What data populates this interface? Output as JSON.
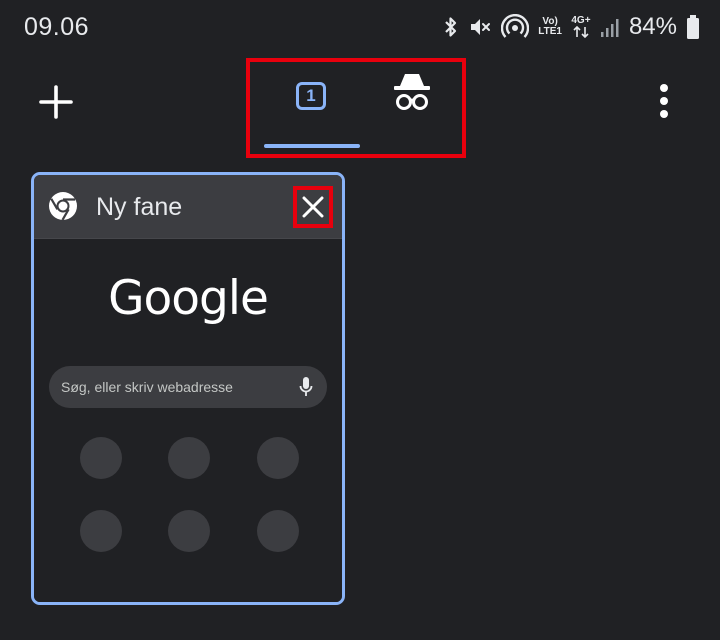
{
  "status_bar": {
    "time": "09.06",
    "network_top": "Vo)",
    "network_bottom": "LTE1",
    "signal_top": "4G+",
    "battery_percent": "84%",
    "icons": [
      "bluetooth-icon",
      "mute-icon",
      "hotspot-icon",
      "volte-icon",
      "4g-icon",
      "signal-icon",
      "battery-icon"
    ]
  },
  "toolbar": {
    "new_tab_icon": "plus-icon",
    "tab_count": "1",
    "incognito_icon": "incognito-icon",
    "menu_icon": "more-vert-icon"
  },
  "tab_card": {
    "title": "Ny fane",
    "close_icon": "close-icon",
    "favicon": "chrome-icon",
    "preview": {
      "logo_text": "Google",
      "search_placeholder": "Søg, eller skriv webadresse",
      "mic_icon": "mic-icon",
      "shortcut_count": 6
    }
  },
  "colors": {
    "background": "#202124",
    "accent": "#8ab4f8",
    "highlight": "#e8000d",
    "card_header": "#3c3d41"
  }
}
